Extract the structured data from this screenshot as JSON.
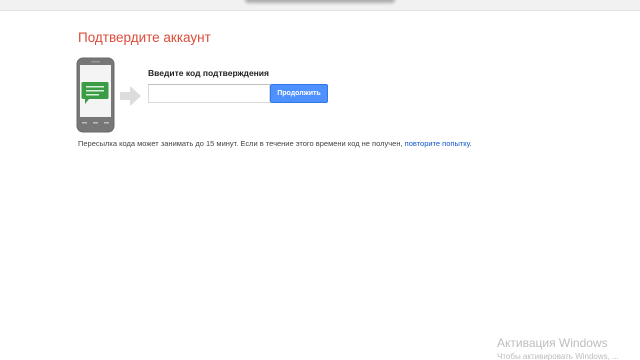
{
  "header": {
    "title": "Подтвердите аккаунт"
  },
  "form": {
    "code_label": "Введите код подтверждения",
    "code_value": "",
    "continue_label": "Продолжить"
  },
  "note": {
    "text": "Пересылка кода может занимать до 15 минут. Если в течение этого времени код не получен, ",
    "link": "повторите попытку",
    "suffix": "."
  },
  "activation": {
    "title": "Активация Windows",
    "subtitle": "Чтобы активировать Windows, ..."
  },
  "colors": {
    "title": "#dd4b39",
    "button": "#4d90fe",
    "link": "#1155cc",
    "message_bubble": "#3c9c46"
  },
  "icons": {
    "phone": "phone-icon",
    "message": "message-bubble-icon",
    "arrow": "arrow-right-icon"
  }
}
